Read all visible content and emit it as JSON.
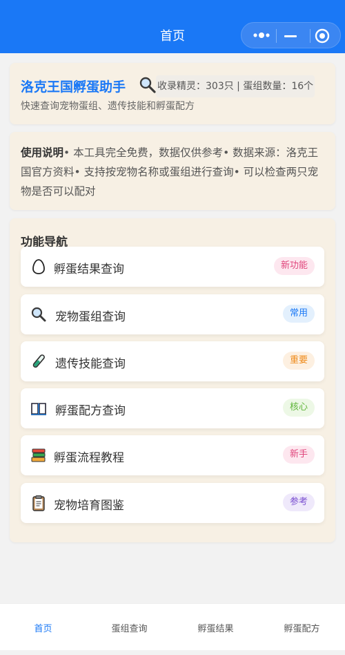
{
  "header": {
    "title": "首页"
  },
  "intro": {
    "app_title": "洛克王国孵蛋助手",
    "stats": "收录精灵：303只 | 蛋组数量：16个",
    "subtitle": "快速查询宠物蛋组、遗传技能和孵蛋配方"
  },
  "usage": {
    "heading": "使用说明",
    "body": "• 本工具完全免费，数据仅供参考• 数据来源：洛克王国官方资料• 支持按宠物名称或蛋组进行查询• 可以检查两只宠物是否可以配对"
  },
  "nav": {
    "title": "功能导航",
    "items": [
      {
        "label": "孵蛋结果查询",
        "badge": "新功能",
        "icon": "egg-icon",
        "badge_bg": "#fde7ef",
        "badge_color": "#e0467c"
      },
      {
        "label": "宠物蛋组查询",
        "badge": "常用",
        "icon": "magnifier-icon",
        "badge_bg": "#e3f0fd",
        "badge_color": "#1a78f6"
      },
      {
        "label": "遗传技能查询",
        "badge": "重要",
        "icon": "test-tube-icon",
        "badge_bg": "#fdf0e1",
        "badge_color": "#ef8b1c"
      },
      {
        "label": "孵蛋配方查询",
        "badge": "核心",
        "icon": "book-icon",
        "badge_bg": "#edf8e6",
        "badge_color": "#5fb53a"
      },
      {
        "label": "孵蛋流程教程",
        "badge": "新手",
        "icon": "books-icon",
        "badge_bg": "#fde7ef",
        "badge_color": "#e0467c"
      },
      {
        "label": "宠物培育图鉴",
        "badge": "参考",
        "icon": "clipboard-icon",
        "badge_bg": "#efe9fb",
        "badge_color": "#7a4fd1"
      }
    ]
  },
  "tabbar": {
    "tabs": [
      {
        "label": "首页",
        "active": true
      },
      {
        "label": "蛋组查询",
        "active": false
      },
      {
        "label": "孵蛋结果",
        "active": false
      },
      {
        "label": "孵蛋配方",
        "active": false
      }
    ]
  },
  "colors": {
    "primary": "#1a78f6",
    "card_bg": "#f7f0e4",
    "page_bg": "#f2f2f2"
  }
}
